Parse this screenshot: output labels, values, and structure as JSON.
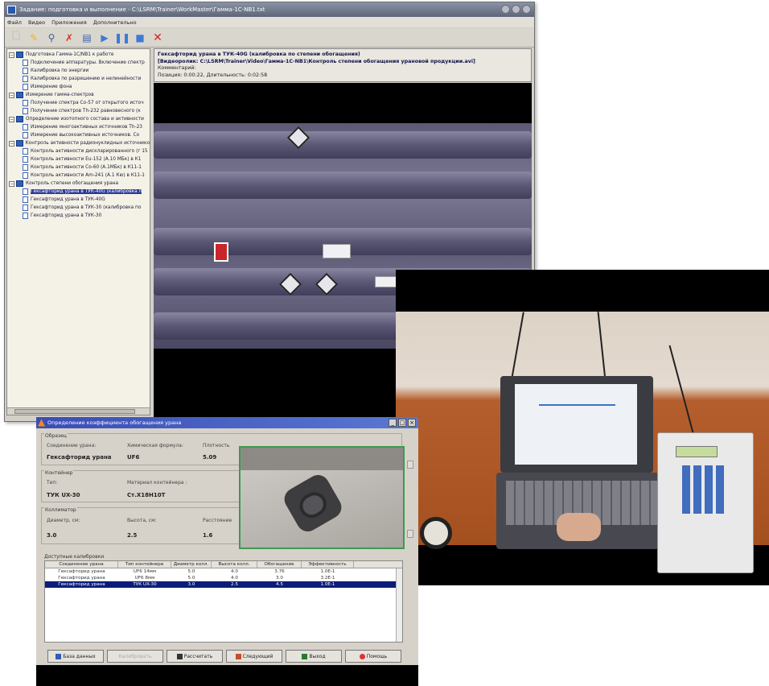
{
  "main_window": {
    "title": "Задание: подготовка и выполнение - C:\\LSRM\\Trainer\\WorkMaster\\Гамма-1С-NB1.txt",
    "menu": [
      "Файл",
      "Видео",
      "Приложения",
      "Дополнительно"
    ],
    "toolbar_icons": [
      "new-file-icon",
      "edit-icon",
      "search-icon",
      "delete-icon",
      "film-icon",
      "play-icon",
      "pause-icon",
      "stop-icon",
      "close-icon"
    ],
    "tree": [
      {
        "level": 0,
        "kind": "book",
        "label": "Подготовка Гамма-1С/NB1 к работе"
      },
      {
        "level": 1,
        "kind": "doc",
        "label": "Подключение аппаратуры. Включение спектр"
      },
      {
        "level": 1,
        "kind": "doc",
        "label": "Калибровка по энергии"
      },
      {
        "level": 1,
        "kind": "doc",
        "label": "Калибровка по разрешению и нелинейности"
      },
      {
        "level": 1,
        "kind": "doc",
        "label": "Измерение фона"
      },
      {
        "level": 0,
        "kind": "book",
        "label": "Измерение гамма-спектров"
      },
      {
        "level": 1,
        "kind": "doc",
        "label": "Получение спектра Co-57 от открытого источ"
      },
      {
        "level": 1,
        "kind": "doc",
        "label": "Получение спектров Th-232 равновесного (к"
      },
      {
        "level": 0,
        "kind": "book",
        "label": "Определение изотопного состава и активности"
      },
      {
        "level": 1,
        "kind": "doc",
        "label": "Измерение многоактивных источников Th-23"
      },
      {
        "level": 1,
        "kind": "doc",
        "label": "Измерение высокоактивных источников. Со"
      },
      {
        "level": 0,
        "kind": "book",
        "label": "Контроль активности радионуклидных источнико"
      },
      {
        "level": 1,
        "kind": "doc",
        "label": "Контроль активности дискларированного (г 15"
      },
      {
        "level": 1,
        "kind": "doc",
        "label": "Контроль активности Eu-152 (А.10 МБк) в К1"
      },
      {
        "level": 1,
        "kind": "doc",
        "label": "Контроль активности Со-60 (А.1МБк) в К11-1"
      },
      {
        "level": 1,
        "kind": "doc",
        "label": "Контроль активности Am-241 (А.1 Кю) в К11-1"
      },
      {
        "level": 0,
        "kind": "book",
        "label": "Контроль степени обогащения урана"
      },
      {
        "level": 1,
        "kind": "doc",
        "label": "Гексафторид урана в ТУК-40G (калибровка п",
        "selected": true
      },
      {
        "level": 1,
        "kind": "doc",
        "label": "Гексафторид урана в ТУК-40G"
      },
      {
        "level": 1,
        "kind": "doc",
        "label": "Гексафторид урана в ТУК-30 (калибровка по"
      },
      {
        "level": 1,
        "kind": "doc",
        "label": "Гексафторид урана в ТУК-30"
      }
    ],
    "info": {
      "line1": "Гексафторид урана в ТУК-40G (калибровка по степени обогащения)",
      "line2": "[Видеоролик: C:\\LSRM\\Trainer\\Video\\Гамма-1С-NB1\\Контроль степени обогащения урановой продукции.avi]",
      "line3": "Комментарий:",
      "line4": "Позиция: 0:00:22, Длительность: 0:02:58"
    }
  },
  "dialog": {
    "title": "Определение коэффициента обогащения урана",
    "sample": {
      "legend": "Образец",
      "compound_label": "Соединение урана:",
      "formula_label": "Химическая формула:",
      "density_label": "Плотность",
      "compound_value": "Гексафторид урана",
      "formula_value": "UF6",
      "density_value": "5.09"
    },
    "container": {
      "legend": "Контейнер",
      "type_label": "Тип:",
      "material_label": "Материал контейнера :",
      "type_value": "ТУК UX-30",
      "material_value": "Ст.Х18Н10Т"
    },
    "collimator": {
      "legend": "Коллиматор",
      "diameter_label": "Диаметр, см:",
      "height_label": "Высота, см:",
      "distance_label": "Расстояние",
      "diameter_value": "3.0",
      "height_value": "2.5",
      "distance_value": "1.6"
    },
    "calibrations": {
      "legend": "Доступные калибровки",
      "columns": [
        "Соединение урана",
        "Тип контейнера",
        "Диаметр колл.",
        "Высота колл.",
        "Обогащение",
        "Эффективность"
      ],
      "rows": [
        [
          "Гексафторид урана",
          "UF6 14мм",
          "5.0",
          "4.0",
          "3.76",
          "1.0E-1"
        ],
        [
          "Гексафторид урана",
          "UF6 8мм",
          "5.0",
          "4.0",
          "3.0",
          "3.2E-1"
        ],
        [
          "Гексафторид урана",
          "ТУК UX-30",
          "3.0",
          "2.5",
          "4.5",
          "1.0E-1"
        ]
      ],
      "selected_row": 2
    },
    "buttons": [
      "База данных",
      "Калибровать",
      "Рассчитать",
      "Следующий",
      "Выход",
      "Помощь"
    ]
  }
}
